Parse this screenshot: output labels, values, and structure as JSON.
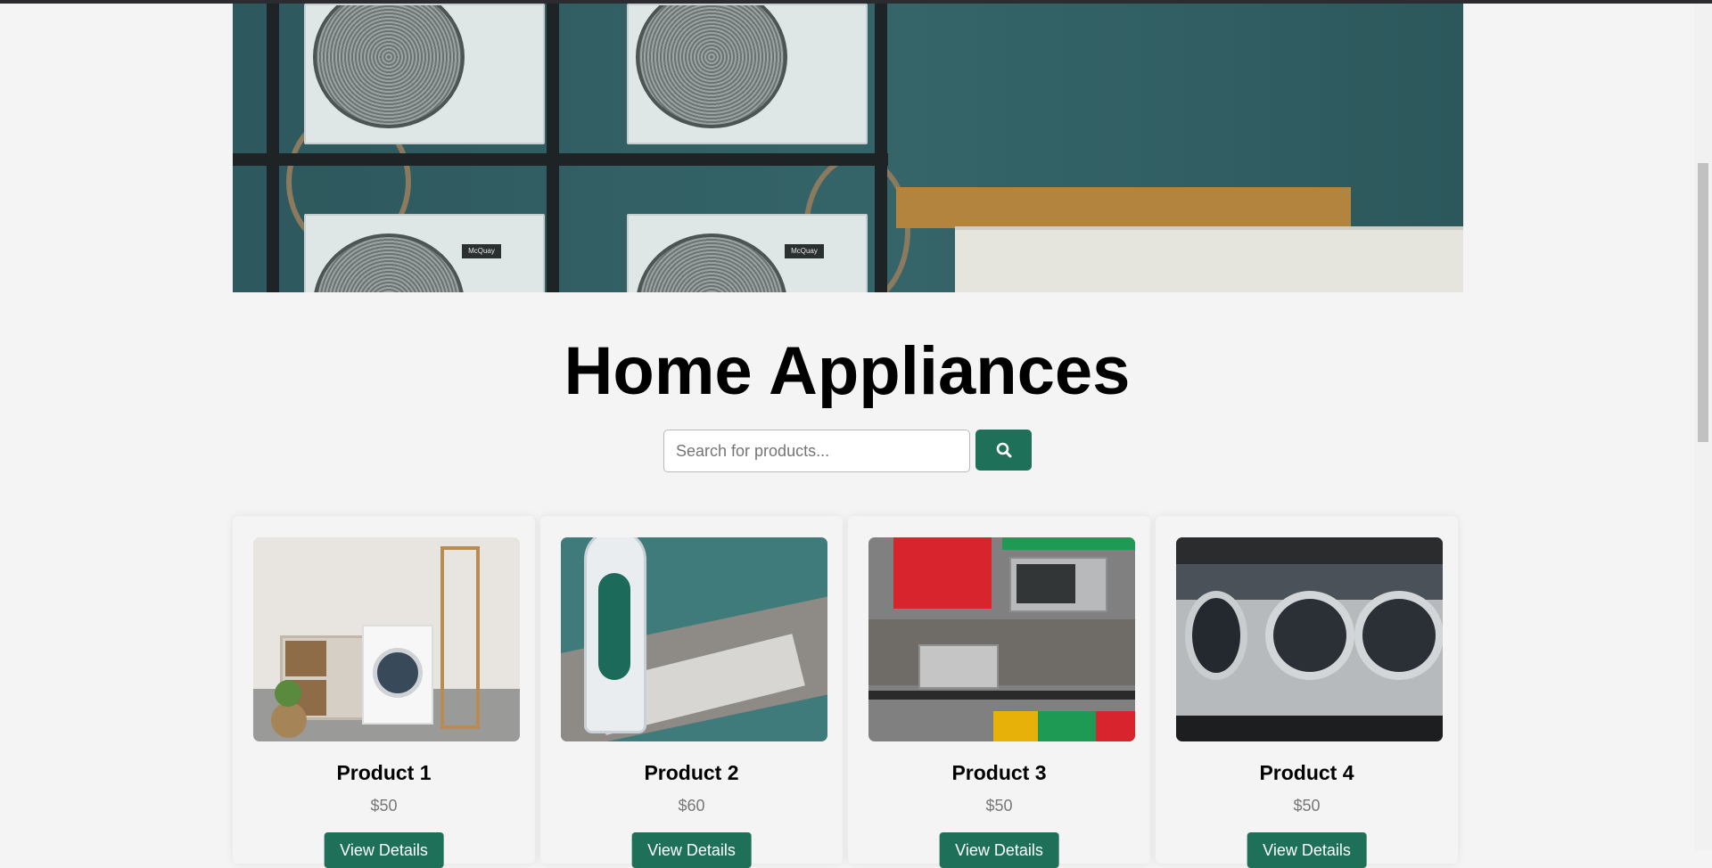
{
  "hero": {
    "image_alt": "Air conditioner units against teal wall",
    "brand_plate": "McQuay"
  },
  "page_title": "Home Appliances",
  "search": {
    "placeholder": "Search for products...",
    "value": "",
    "button_icon": "search-icon"
  },
  "products": [
    {
      "name": "Product 1",
      "price": "$50",
      "button": "View Details",
      "image": "washing-machine-room"
    },
    {
      "name": "Product 2",
      "price": "$60",
      "button": "View Details",
      "image": "steam-iron"
    },
    {
      "name": "Product 3",
      "price": "$50",
      "button": "View Details",
      "image": "kitchen-microwave"
    },
    {
      "name": "Product 4",
      "price": "$50",
      "button": "View Details",
      "image": "laundromat-washers"
    }
  ],
  "colors": {
    "accent": "#1f7058",
    "background": "#f4f4f4",
    "price": "#777777"
  }
}
